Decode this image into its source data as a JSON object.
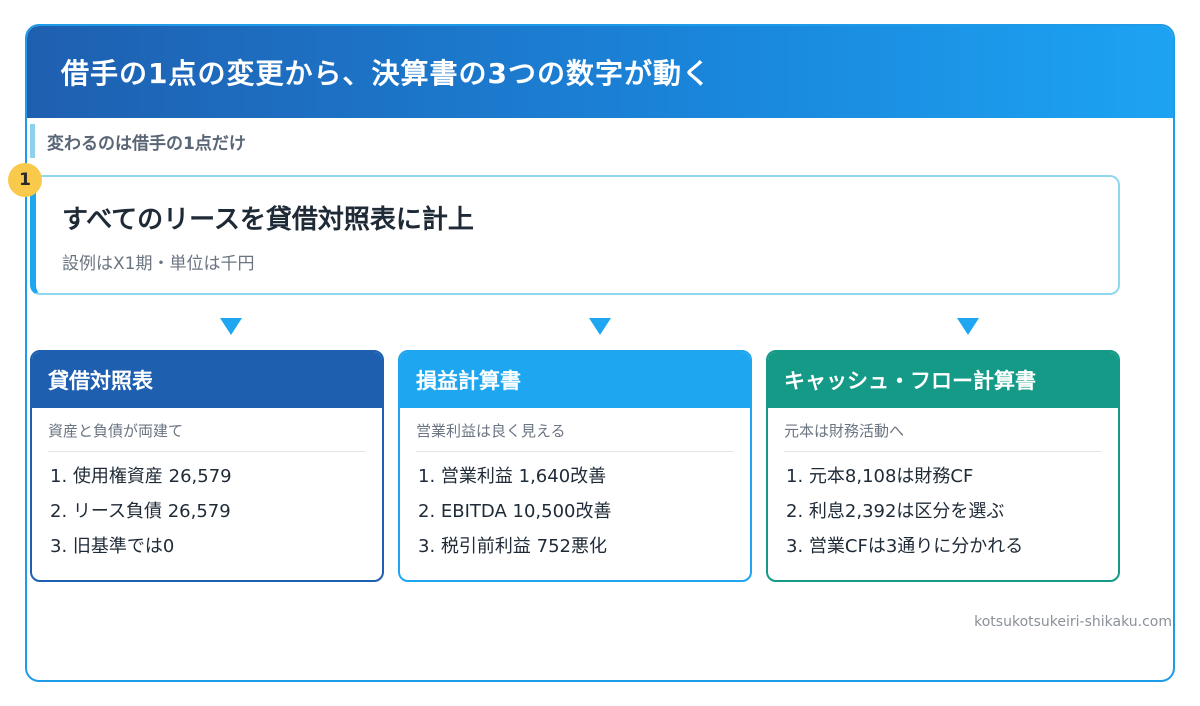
{
  "header": {
    "title": "借手の1点の変更から、決算書の3つの数字が動く"
  },
  "section_label": "変わるのは借手の1点だけ",
  "step": {
    "number": "1",
    "title": "すべてのリースを貸借対照表に計上",
    "subtitle": "設例はX1期・単位は千円"
  },
  "statements": [
    {
      "title": "貸借対照表",
      "subtitle": "資産と負債が両建て",
      "items": [
        "1. 使用権資産 26,579",
        "2. リース負債 26,579",
        "3. 旧基準では0"
      ],
      "color": "#1f5fb0"
    },
    {
      "title": "損益計算書",
      "subtitle": "営業利益は良く見える",
      "items": [
        "1. 営業利益 1,640改善",
        "2. EBITDA 10,500改善",
        "3. 税引前利益 752悪化"
      ],
      "color": "#1ea7f0"
    },
    {
      "title": "キャッシュ・フロー計算書",
      "subtitle": "元本は財務活動へ",
      "items": [
        "1. 元本8,108は財務CF",
        "2. 利息2,392は区分を選ぶ",
        "3. 営業CFは3通りに分かれる"
      ],
      "color": "#159a88"
    }
  ],
  "footer": "kotsukotsukeiri-shikaku.com"
}
